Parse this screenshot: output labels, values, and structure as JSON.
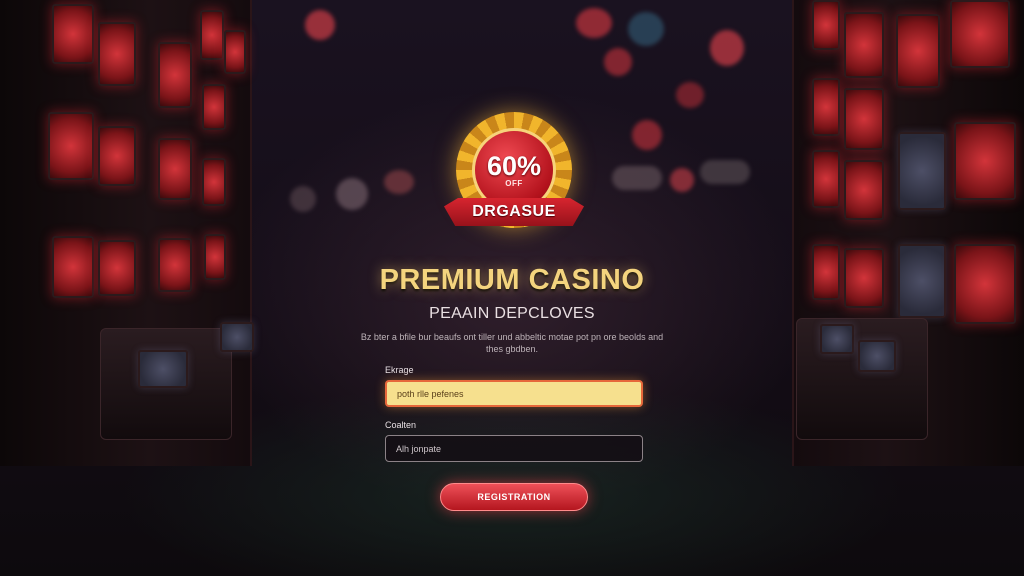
{
  "badge": {
    "percent": "60%",
    "off_text": "OFF",
    "ribbon": "DRGASUE"
  },
  "page": {
    "title": "PREMIUM CASINO",
    "subtitle": "PEAAIN DEPCLOVES",
    "description": "Bz bter a bfile bur beaufs ont tiller und abbeltic motae pot pn ore beolds and thes gbdben."
  },
  "form": {
    "field1": {
      "label": "Ekrage",
      "placeholder": "poth rlle pefenes"
    },
    "field2": {
      "label": "Coalten",
      "placeholder": "Alh jonpate"
    },
    "submit_label": "REGISTRATION"
  },
  "colors": {
    "title_gold": "#f4d47e",
    "button_red": "#d8303a",
    "input_highlight": "#f6e08e",
    "background": "#120c14"
  }
}
